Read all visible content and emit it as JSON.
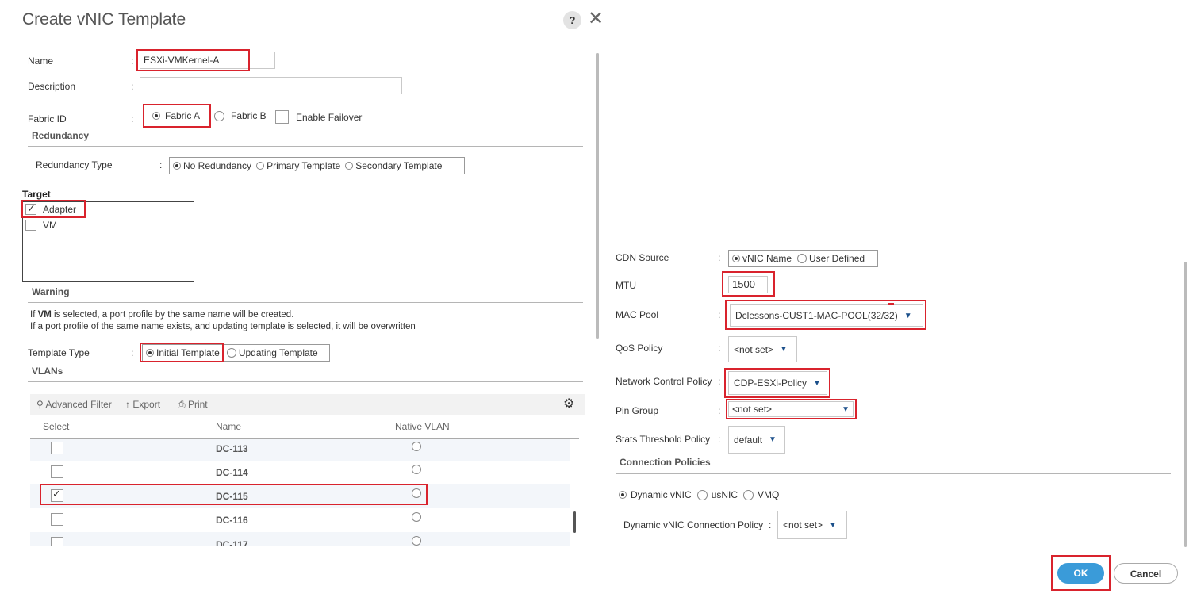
{
  "dialog": {
    "title": "Create vNIC Template",
    "help_label": "?",
    "close_label": "✕"
  },
  "form": {
    "name": {
      "label": "Name",
      "value": "ESXi-VMKernel-A"
    },
    "description": {
      "label": "Description",
      "value": ""
    },
    "fabric_id": {
      "label": "Fabric ID",
      "options": [
        "Fabric A",
        "Fabric B"
      ],
      "selected": "Fabric A",
      "failover_label": "Enable Failover",
      "failover_checked": false
    },
    "redundancy": {
      "section": "Redundancy",
      "label": "Redundancy Type",
      "options": [
        "No Redundancy",
        "Primary Template",
        "Secondary Template"
      ],
      "selected": "No Redundancy"
    },
    "target": {
      "label": "Target",
      "items": [
        {
          "label": "Adapter",
          "checked": true
        },
        {
          "label": "VM",
          "checked": false
        }
      ]
    },
    "warning": {
      "section": "Warning",
      "line1_prefix": "If ",
      "line1_bold": "VM",
      "line1_suffix": " is selected, a port profile by the same name will be created.",
      "line2": "If a port profile of the same name exists, and updating template is selected, it will be overwritten"
    },
    "template_type": {
      "label": "Template Type",
      "options": [
        "Initial Template",
        "Updating Template"
      ],
      "selected": "Initial Template"
    },
    "colon": ":"
  },
  "vlans": {
    "section": "VLANs",
    "toolbar": {
      "filter": "Advanced Filter",
      "export": "Export",
      "print": "Print"
    },
    "columns": [
      "Select",
      "Name",
      "Native VLAN"
    ],
    "rows": [
      {
        "name": "DC-113",
        "selected": false
      },
      {
        "name": "DC-114",
        "selected": false
      },
      {
        "name": "DC-115",
        "selected": true
      },
      {
        "name": "DC-116",
        "selected": false
      },
      {
        "name": "DC-117",
        "selected": false
      }
    ]
  },
  "right": {
    "cdn_source": {
      "label": "CDN Source",
      "options": [
        "vNIC Name",
        "User Defined"
      ],
      "selected": "vNIC Name"
    },
    "mtu": {
      "label": "MTU",
      "value": "1500"
    },
    "mac_pool": {
      "label": "MAC Pool",
      "value": "Dclessons-CUST1-MAC-POOL(32/32)"
    },
    "qos_policy": {
      "label": "QoS Policy",
      "value": "<not set>"
    },
    "network_control_policy": {
      "label": "Network Control Policy",
      "value": "CDP-ESXi-Policy"
    },
    "pin_group": {
      "label": "Pin Group",
      "value": "<not set>"
    },
    "stats_threshold_policy": {
      "label": "Stats Threshold Policy",
      "value": "default"
    },
    "connection_policies": {
      "section": "Connection Policies",
      "options": [
        "Dynamic vNIC",
        "usNIC",
        "VMQ"
      ],
      "selected": "Dynamic vNIC"
    },
    "dynamic_vnic_policy": {
      "label": "Dynamic vNIC Connection Policy",
      "value": "<not set>"
    }
  },
  "buttons": {
    "ok": "OK",
    "cancel": "Cancel"
  },
  "colors": {
    "highlight": "#d9232d",
    "ok_button": "#3a9bd9"
  }
}
